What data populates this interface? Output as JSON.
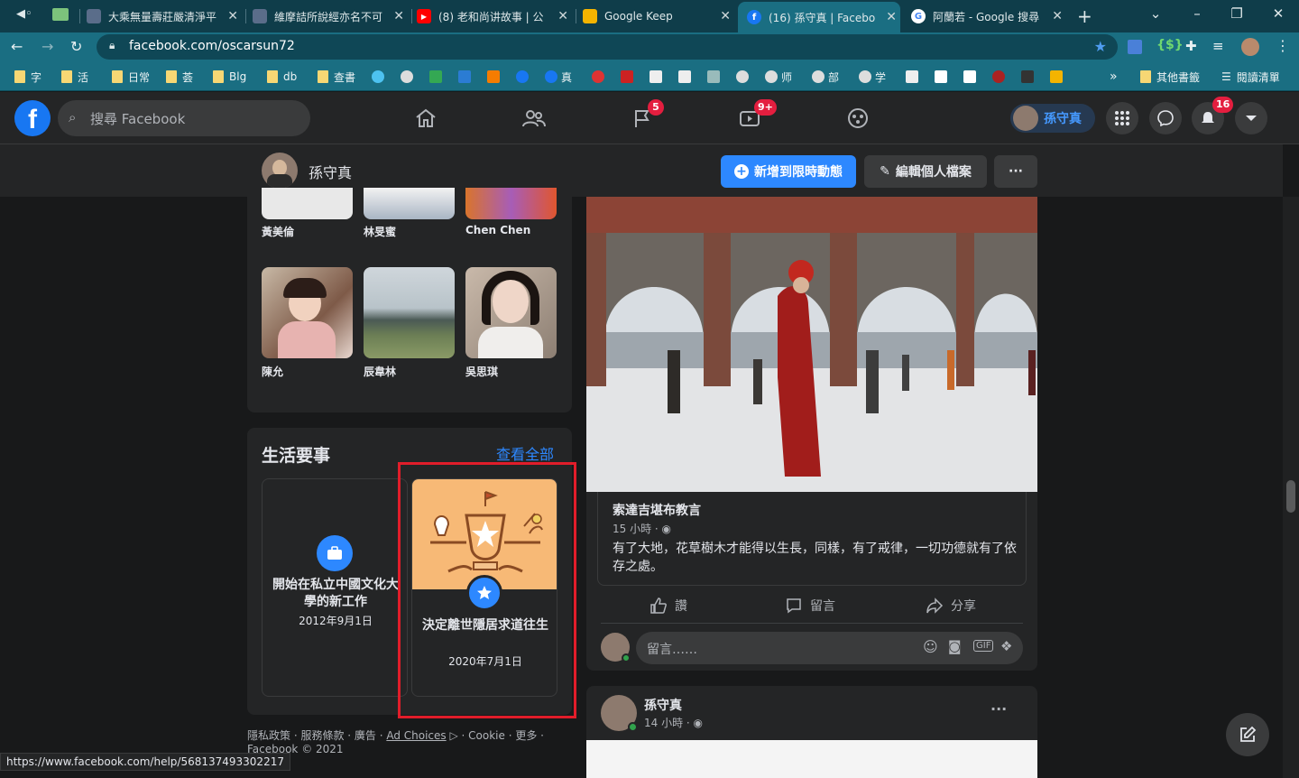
{
  "browser": {
    "tabs": [
      {
        "title": "大乘無量壽莊嚴清淨平",
        "color": "#5a6d8a"
      },
      {
        "title": "維摩詰所說經亦名不可",
        "color": "#5a6d8a"
      },
      {
        "title": "(8) 老和尚讲故事 | 公",
        "color": "#ff0000"
      },
      {
        "title": "Google Keep",
        "color": "#f4b400"
      },
      {
        "title": "(16) 孫守真 | Faceboo",
        "color": "#1877f2"
      },
      {
        "title": "阿蘭若 - Google 搜尋",
        "color": "#ffffff"
      }
    ],
    "new_tab": "+",
    "url": "facebook.com/oscarsun72",
    "bookmarks": [
      "字",
      "活",
      "日常",
      "荟",
      "Blg",
      "db",
      "查書",
      "真",
      "师",
      "部",
      "学"
    ],
    "bookmarks_more": "»",
    "bookmarks_other": "其他書籤",
    "reading_list": "閱讀清單"
  },
  "fb": {
    "logo": "f",
    "search_placeholder": "搜尋 Facebook",
    "notif_groups": "5",
    "notif_watch": "9+",
    "notif_bell": "16",
    "user_short": "孫守真"
  },
  "profile": {
    "name": "孫守真",
    "add_story": "新增到限時動態",
    "edit_profile": "編輯個人檔案",
    "more": "···"
  },
  "friends": [
    {
      "name": "黃美倫"
    },
    {
      "name": "林旻蜜"
    },
    {
      "name": "Chen Chen"
    },
    {
      "name": "陳允"
    },
    {
      "name": "辰韋林"
    },
    {
      "name": "吳思琪"
    }
  ],
  "life_events": {
    "title": "生活要事",
    "see_all": "查看全部",
    "items": [
      {
        "title": "開始在私立中國文化大學的新工作",
        "date": "2012年9月1日"
      },
      {
        "title": "決定離世隱居求道往生",
        "date": "2020年7月1日"
      }
    ]
  },
  "footer": {
    "line1_a": "隱私政策 · 服務條款 · 廣告 · ",
    "ad_choices": "Ad Choices",
    "line1_b": " · Cookie · 更多 ·",
    "line2": "Facebook © 2021"
  },
  "post": {
    "shared_title": "索達吉堪布教言",
    "shared_time": "15 小時 ·",
    "shared_text": "有了大地，花草樹木才能得以生長，同樣，有了戒律，一切功德就有了依存之處。",
    "like": "讚",
    "comment": "留言",
    "share": "分享",
    "comment_placeholder": "留言……"
  },
  "post2": {
    "author": "孫守真",
    "time": "14 小時 ·",
    "more": "···"
  },
  "status_url": "https://www.facebook.com/help/568137493302217"
}
